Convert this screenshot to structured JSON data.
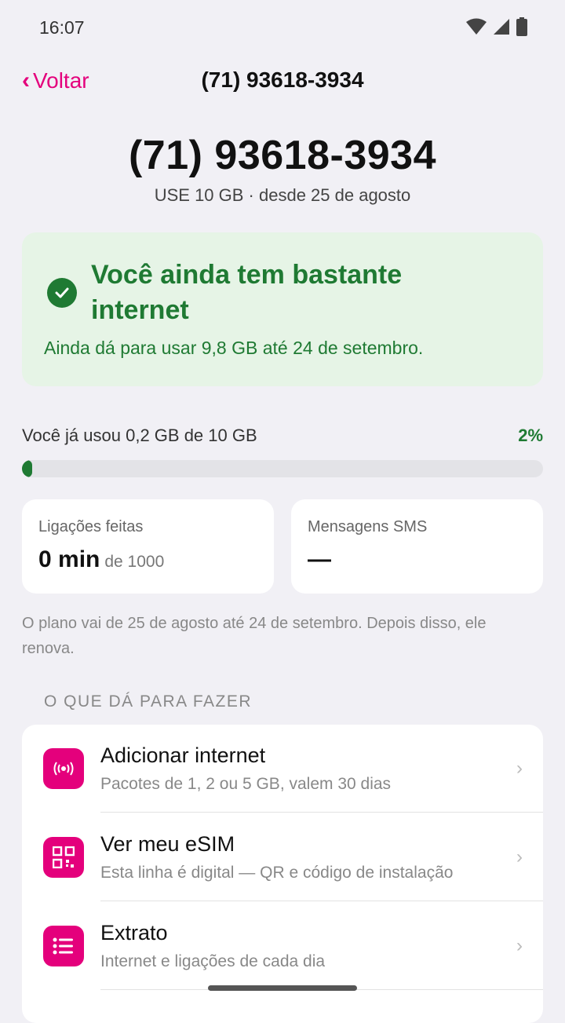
{
  "status_bar": {
    "time": "16:07",
    "icons": [
      "wifi-icon",
      "signal-icon",
      "battery-icon"
    ]
  },
  "nav": {
    "back_label": "Voltar",
    "title": "(71) 93618-3934"
  },
  "hero": {
    "number": "(71) 93618-3934",
    "subtitle": "USE 10 GB · desde 25 de agosto"
  },
  "status_card": {
    "title": "Você ainda tem bastante internet",
    "description": "Ainda dá para usar 9,8 GB até 24 de setembro.",
    "color": "#1f7a33"
  },
  "usage": {
    "label": "Você já usou 0,2 GB de 10 GB",
    "percent_label": "2%",
    "percent": 2
  },
  "stats": {
    "calls": {
      "label": "Ligações feitas",
      "value": "0 min",
      "unit": "de 1000"
    },
    "sms": {
      "label": "Mensagens SMS",
      "value": "—"
    }
  },
  "plan_note": "O plano vai de 25 de agosto até 24 de setembro. Depois disso, ele renova.",
  "section_title": "O QUE DÁ PARA FAZER",
  "actions": [
    {
      "title": "Adicionar internet",
      "description": "Pacotes de 1, 2 ou 5 GB, valem 30 dias",
      "icon": "broadcast-icon"
    },
    {
      "title": "Ver meu eSIM",
      "description": "Esta linha é digital — QR e código de instalação",
      "icon": "qr-code-icon"
    },
    {
      "title": "Extrato",
      "description": "Internet e ligações de cada dia",
      "icon": "list-icon"
    }
  ],
  "colors": {
    "accent": "#e4007c",
    "success": "#1f7a33",
    "background": "#f1f0f5"
  }
}
